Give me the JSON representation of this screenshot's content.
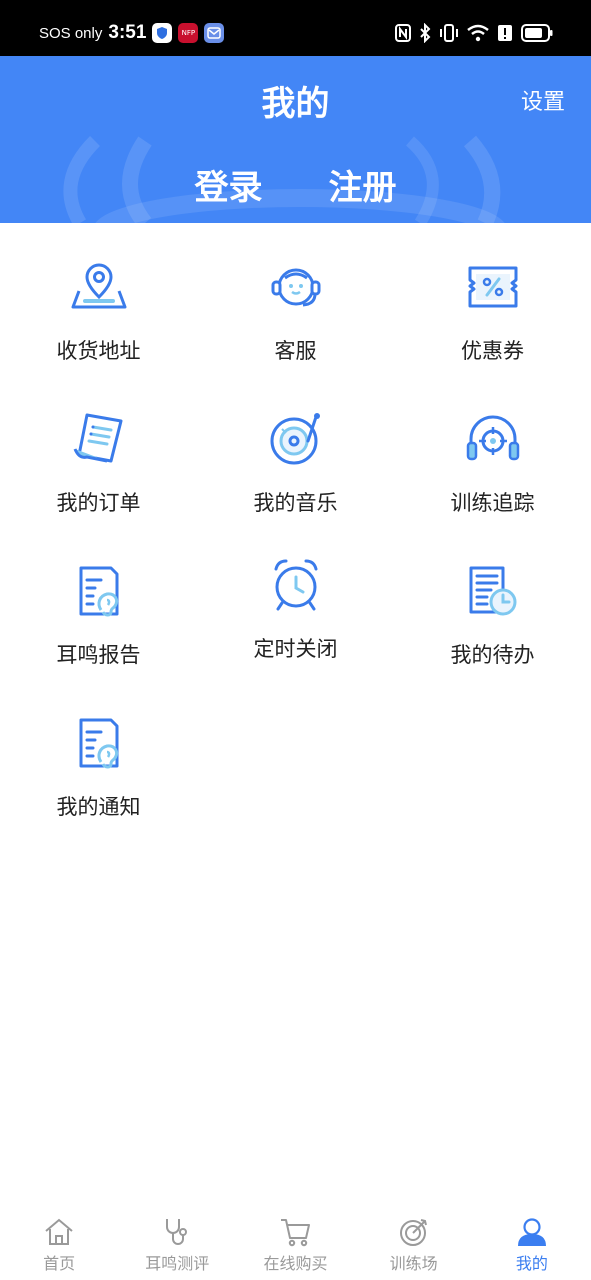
{
  "status_bar": {
    "carrier": "SOS only",
    "time": "3:51",
    "app2_text": "NFP"
  },
  "header": {
    "title": "我的",
    "settings_label": "设置",
    "login_label": "登录",
    "register_label": "注册"
  },
  "menu": {
    "items": [
      {
        "label": "收货地址",
        "icon": "location-map-icon"
      },
      {
        "label": "客服",
        "icon": "headset-service-icon"
      },
      {
        "label": "优惠券",
        "icon": "coupon-icon"
      },
      {
        "label": "我的订单",
        "icon": "receipt-icon"
      },
      {
        "label": "我的音乐",
        "icon": "music-disc-icon"
      },
      {
        "label": "训练追踪",
        "icon": "headphones-target-icon"
      },
      {
        "label": "耳鸣报告",
        "icon": "ear-report-icon"
      },
      {
        "label": "定时关闭",
        "icon": "alarm-clock-icon"
      },
      {
        "label": "我的待办",
        "icon": "todo-document-clock-icon"
      },
      {
        "label": "我的通知",
        "icon": "ear-notice-icon"
      }
    ]
  },
  "bottom_nav": {
    "items": [
      {
        "label": "首页",
        "icon": "home-icon",
        "active": false
      },
      {
        "label": "耳鸣测评",
        "icon": "stethoscope-icon",
        "active": false
      },
      {
        "label": "在线购买",
        "icon": "cart-icon",
        "active": false
      },
      {
        "label": "训练场",
        "icon": "target-icon",
        "active": false
      },
      {
        "label": "我的",
        "icon": "user-icon",
        "active": true
      }
    ]
  },
  "colors": {
    "brand_blue": "#4386f6",
    "icon_blue": "#3a7bea",
    "icon_light": "#7ec8f0",
    "nav_inactive": "#9a9a9a",
    "nav_active": "#3b7ef0"
  }
}
